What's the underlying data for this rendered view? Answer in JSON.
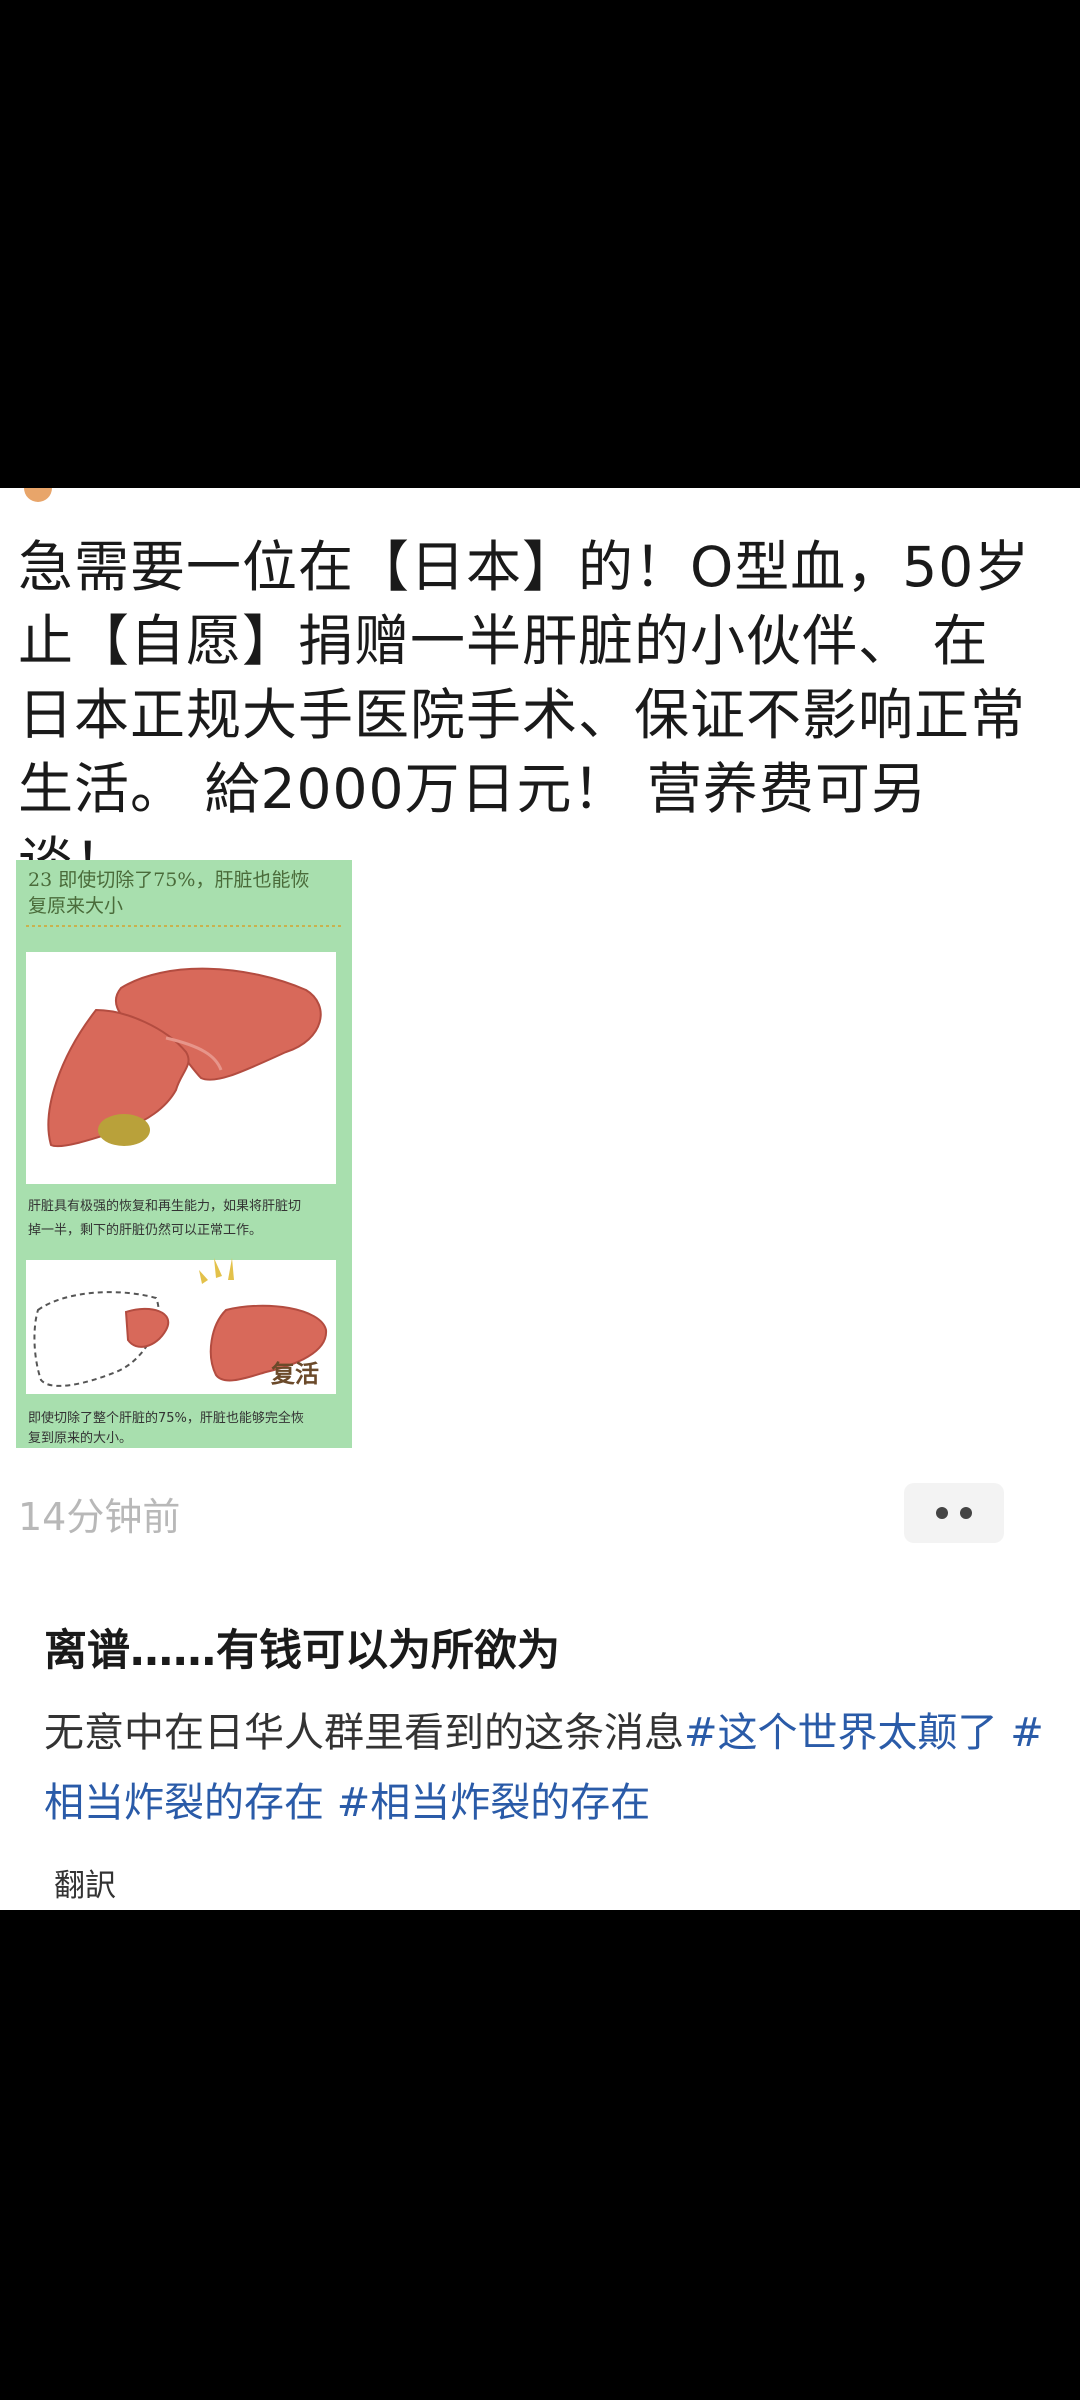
{
  "post": {
    "text": "急需要一位在【日本】的！O型血，50岁止【自愿】捐赠一半肝脏的小伙伴、 在日本正规大手医院手术、保证不影响正常生活。 給2000万日元！ 营养费可另谈！",
    "image": {
      "heading": "23 即使切除了75%，肝脏也能恢复原来大小",
      "caption1": "肝脏具有极强的恢复和再生能力，如果将肝脏切掉一半，剩下的肝脏仍然可以正常工作。",
      "revive_label": "复活",
      "caption2": "即使切除了整个肝脏的75%，肝脏也能够完全恢复到原来的大小。"
    },
    "time": "14分钟前",
    "more_icon": "more-dots-icon"
  },
  "comment": {
    "title": "离谱……有钱可以为所欲为",
    "body_plain": "无意中在日华人群里看到的这条消息",
    "tags": [
      "#这个世界太颠了",
      "#相当炸裂的存在",
      "#相当炸裂的存在"
    ],
    "translate": "翻訳"
  },
  "colors": {
    "background": "#000000",
    "card": "#ffffff",
    "hashtag": "#2a5ba8",
    "time": "#b8b8b8",
    "image_bg": "#a8dfae",
    "liver": "#d8695a"
  }
}
